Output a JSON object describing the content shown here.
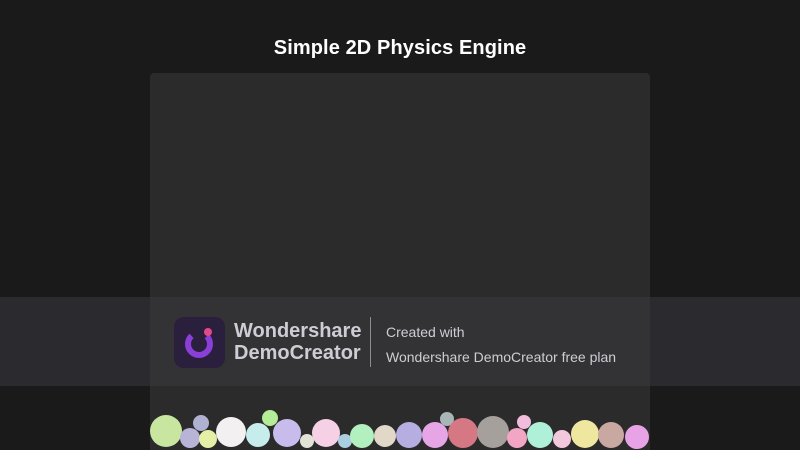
{
  "page": {
    "title": "Simple 2D Physics Engine"
  },
  "canvas": {
    "background": "#2b2b2c"
  },
  "watermark": {
    "brand_line_1": "Wondershare",
    "brand_line_2": "DemoCreator",
    "created_line_1": "Created with",
    "created_line_2": "Wondershare DemoCreator free plan",
    "logo_icon": "democreator-logo-icon",
    "accent_color": "#8a3fd6"
  },
  "balls": {
    "count_visible": 24,
    "colors": [
      "#c8e6a0",
      "#b8b4d8",
      "#b0b0d0",
      "#e6efa6",
      "#f2f0f0",
      "#c6ecec",
      "#b4ec98",
      "#c8bcec",
      "#f6d0e4",
      "#e2e2d6",
      "#aacfe0",
      "#b2f0c0",
      "#e2d8c8",
      "#b6aee0",
      "#e6a6e6",
      "#d67884",
      "#a6a09c",
      "#a8b6b8",
      "#f2a6c4",
      "#f2bcdc",
      "#aef0d8",
      "#f2c8dc",
      "#efe6a0",
      "#c8a8a0",
      "#e8a2e6"
    ]
  }
}
